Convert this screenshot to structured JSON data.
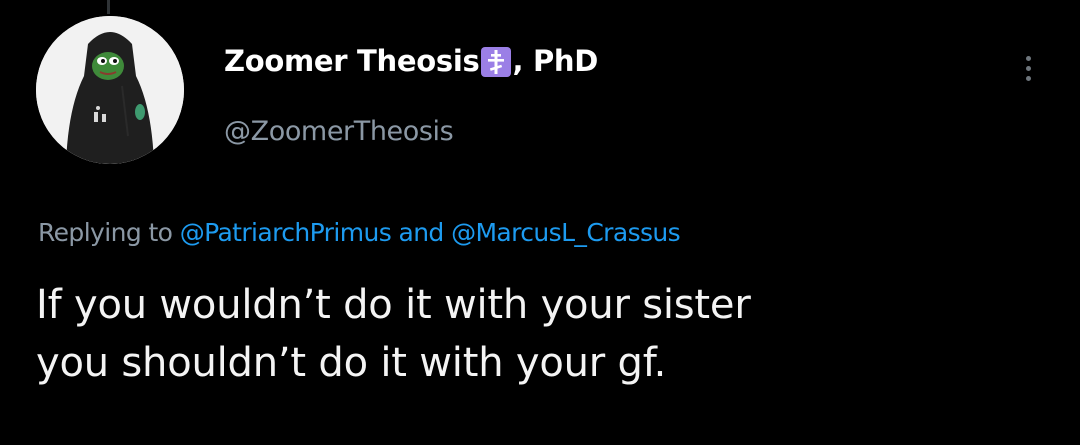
{
  "author": {
    "display_name": "Zoomer Theosis",
    "name_suffix": ", PhD",
    "badge_icon": "orthodox-cross-icon",
    "badge_color": "#9b7fe6",
    "handle": "@ZoomerTheosis",
    "avatar_icon": "hooded-frog-avatar"
  },
  "reply": {
    "prefix": "Replying to ",
    "mention_1": "@PatriarchPrimus",
    "joiner": " and ",
    "mention_2": "@MarcusL_Crassus"
  },
  "tweet": {
    "line_1": "If you wouldn’t do it with your sister",
    "line_2": "you shouldn’t do it with your gf."
  },
  "menu": {
    "icon": "more-options-icon"
  },
  "colors": {
    "background": "#000000",
    "text": "#e7e9ea",
    "secondary": "#8b98a5",
    "link": "#1d9bf0"
  }
}
